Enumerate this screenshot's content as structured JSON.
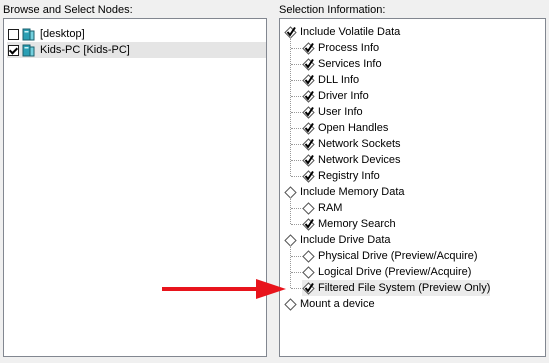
{
  "left_panel": {
    "label": "Browse and Select Nodes:",
    "nodes": [
      {
        "label": "[desktop]",
        "checked": false
      },
      {
        "label": "Kids-PC [Kids-PC]",
        "checked": true,
        "selected": true
      }
    ]
  },
  "right_panel": {
    "label": "Selection Information:",
    "groups": [
      {
        "label": "Include Volatile Data",
        "state": "checked",
        "children": [
          {
            "label": "Process Info",
            "state": "checked"
          },
          {
            "label": "Services Info",
            "state": "checked"
          },
          {
            "label": "DLL Info",
            "state": "checked"
          },
          {
            "label": "Driver Info",
            "state": "checked"
          },
          {
            "label": "User Info",
            "state": "checked"
          },
          {
            "label": "Open Handles",
            "state": "checked"
          },
          {
            "label": "Network Sockets",
            "state": "checked"
          },
          {
            "label": "Network Devices",
            "state": "checked"
          },
          {
            "label": "Registry Info",
            "state": "checked"
          }
        ]
      },
      {
        "label": "Include Memory Data",
        "state": "unchecked",
        "children": [
          {
            "label": "RAM",
            "state": "unchecked"
          },
          {
            "label": "Memory Search",
            "state": "checked"
          }
        ]
      },
      {
        "label": "Include Drive Data",
        "state": "unchecked",
        "children": [
          {
            "label": "Physical Drive (Preview/Acquire)",
            "state": "unchecked"
          },
          {
            "label": "Logical Drive (Preview/Acquire)",
            "state": "unchecked"
          },
          {
            "label": "Filtered File System (Preview Only)",
            "state": "checked",
            "highlighted": true
          }
        ]
      },
      {
        "label": "Mount a device",
        "state": "unchecked",
        "children": []
      }
    ]
  },
  "colors": {
    "arrow": "#e8141c",
    "pane_border": "#828790",
    "selected_row": "#e5e5e5"
  }
}
